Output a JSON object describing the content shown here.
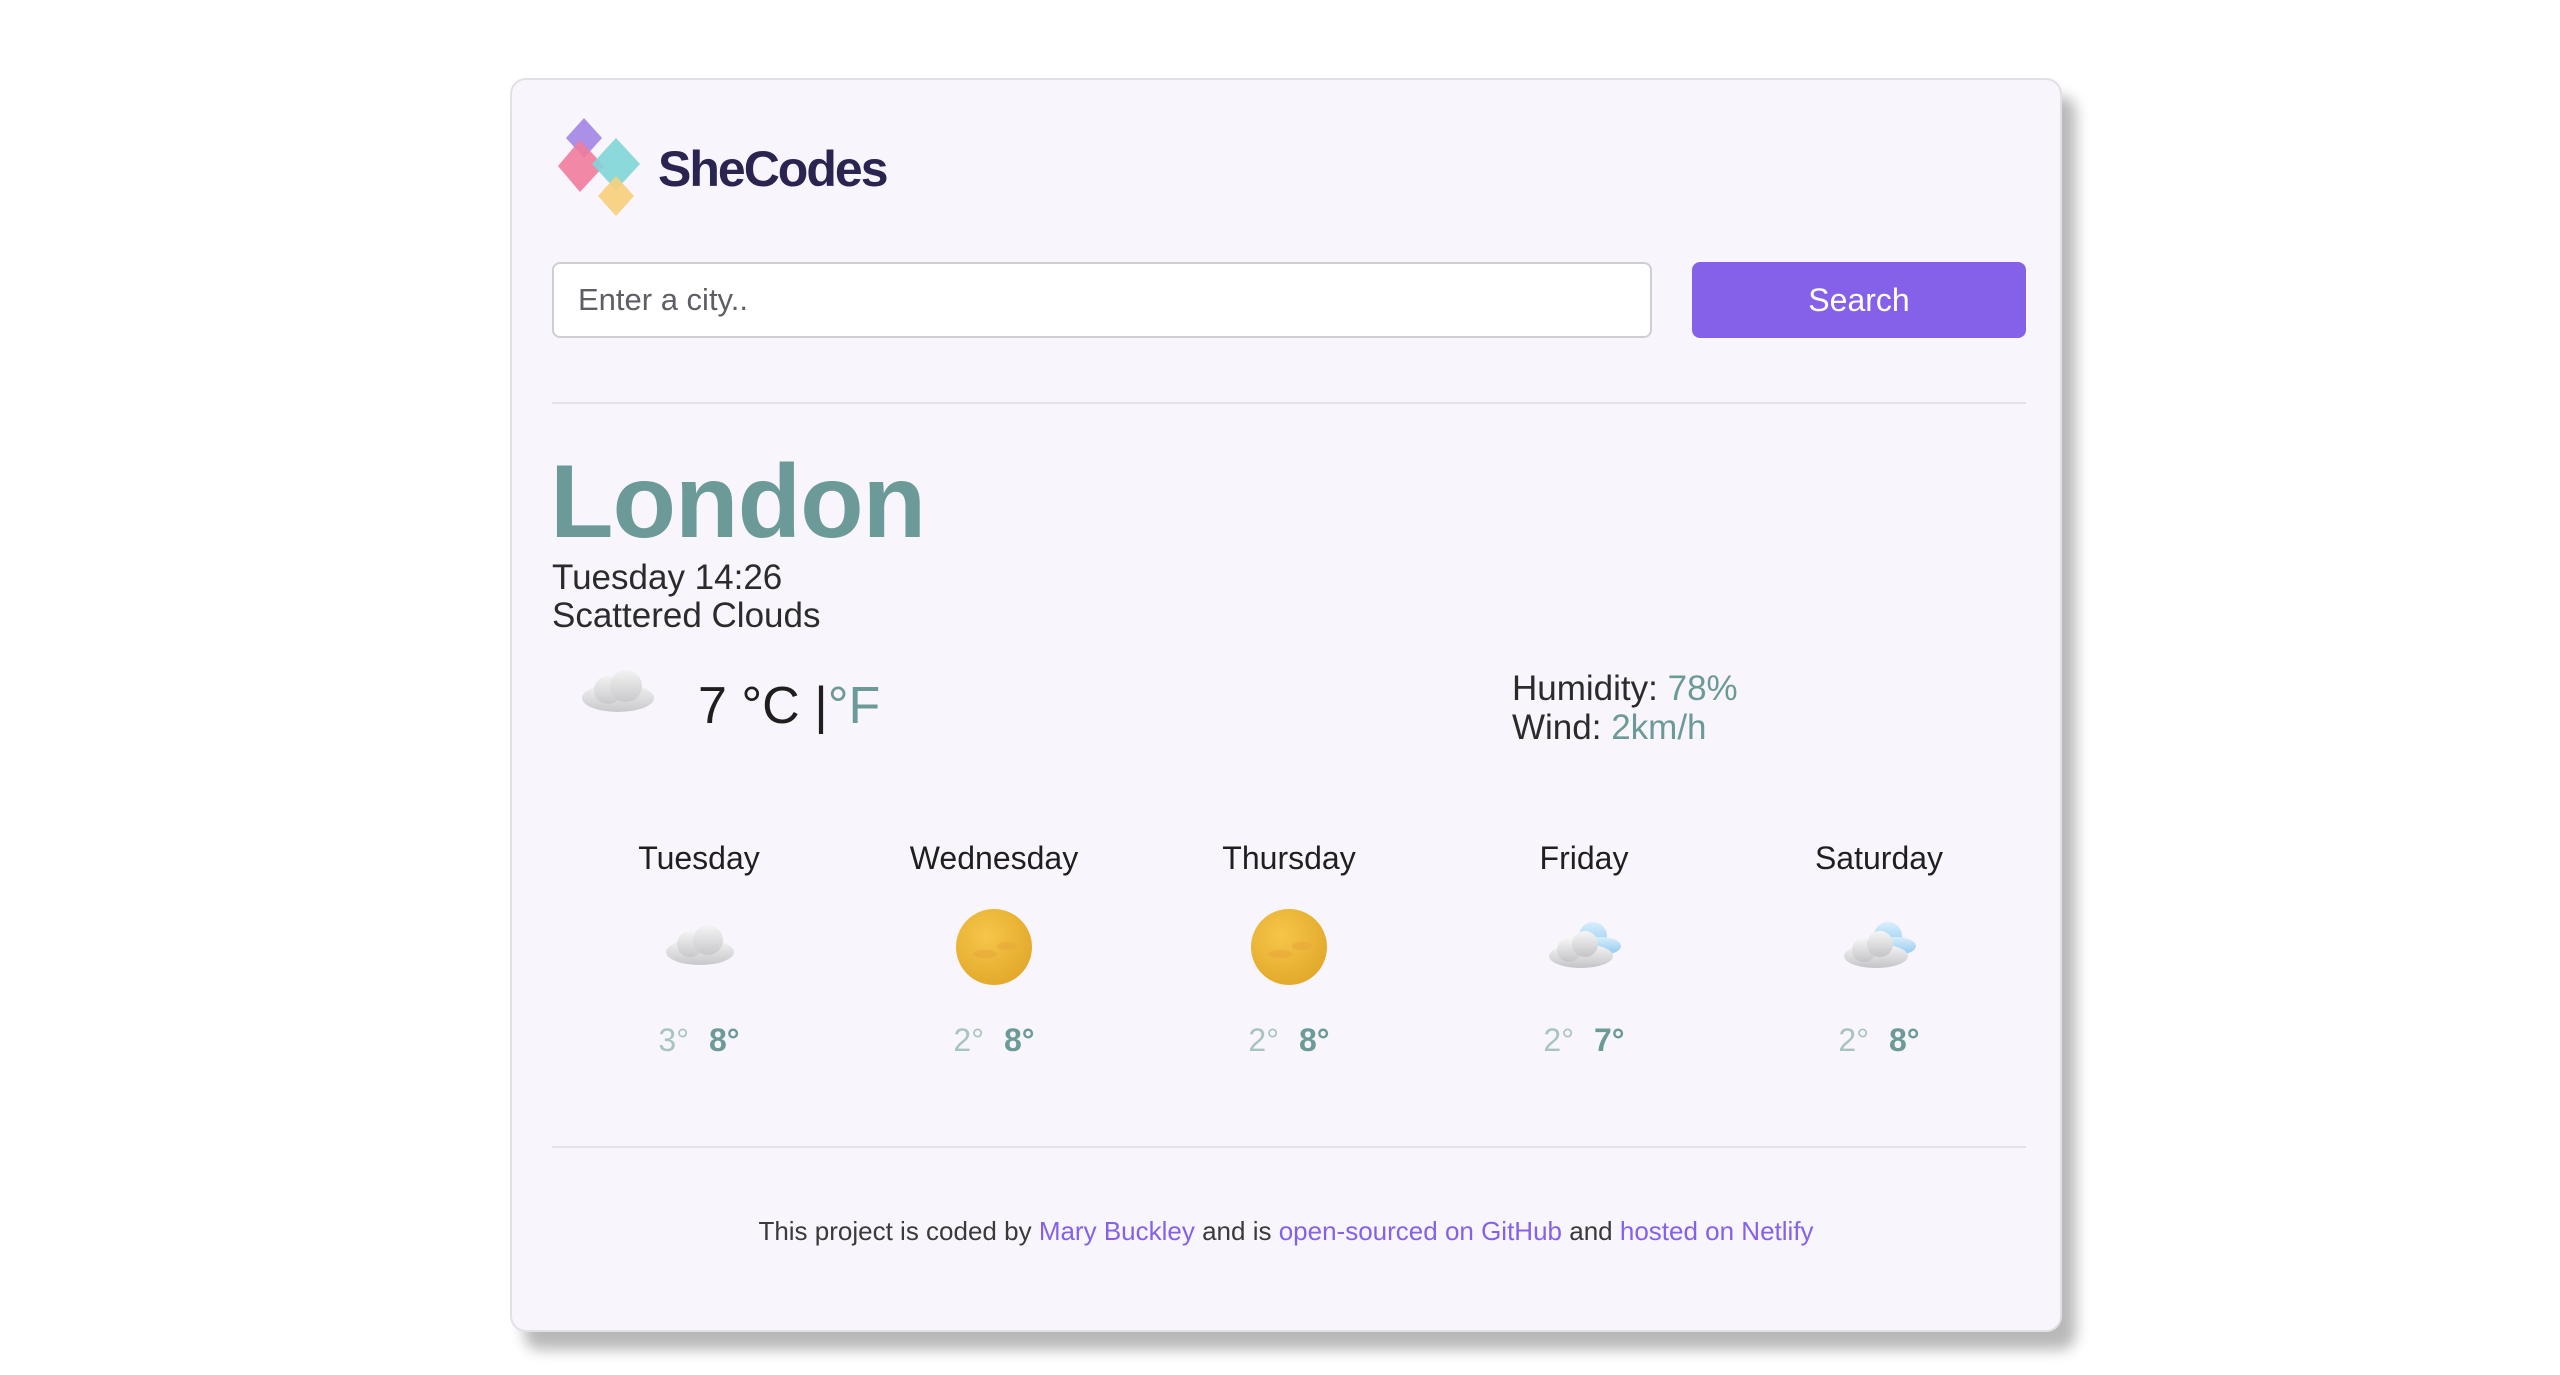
{
  "brand": {
    "name": "SheCodes"
  },
  "search": {
    "placeholder": "Enter a city..",
    "value": "",
    "button_label": "Search"
  },
  "current": {
    "city": "London",
    "datetime": "Tuesday 14:26",
    "description": "Scattered Clouds",
    "icon": "cloud-icon",
    "temperature": "7",
    "unit_c": "°C",
    "separator": "|",
    "unit_f": "°F",
    "humidity_label": "Humidity:",
    "humidity_value": "78%",
    "wind_label": "Wind:",
    "wind_value": "2km/h"
  },
  "forecast": [
    {
      "day": "Tuesday",
      "icon": "cloud-icon",
      "min": "3°",
      "max": "8°"
    },
    {
      "day": "Wednesday",
      "icon": "sun-icon",
      "min": "2°",
      "max": "8°"
    },
    {
      "day": "Thursday",
      "icon": "sun-icon",
      "min": "2°",
      "max": "8°"
    },
    {
      "day": "Friday",
      "icon": "cloud-blue-icon",
      "min": "2°",
      "max": "7°"
    },
    {
      "day": "Saturday",
      "icon": "cloud-blue-icon",
      "min": "2°",
      "max": "8°"
    }
  ],
  "footer": {
    "text_1": "This project is coded by",
    "author_link": "Mary Buckley",
    "text_2": "and is",
    "github_link": "open-sourced on GitHub",
    "text_3": "and",
    "netlify_link": "hosted on Netlify"
  },
  "colors": {
    "accent": "#8461e8",
    "teal": "#6c9a98",
    "card_bg": "#f8f5fc"
  }
}
